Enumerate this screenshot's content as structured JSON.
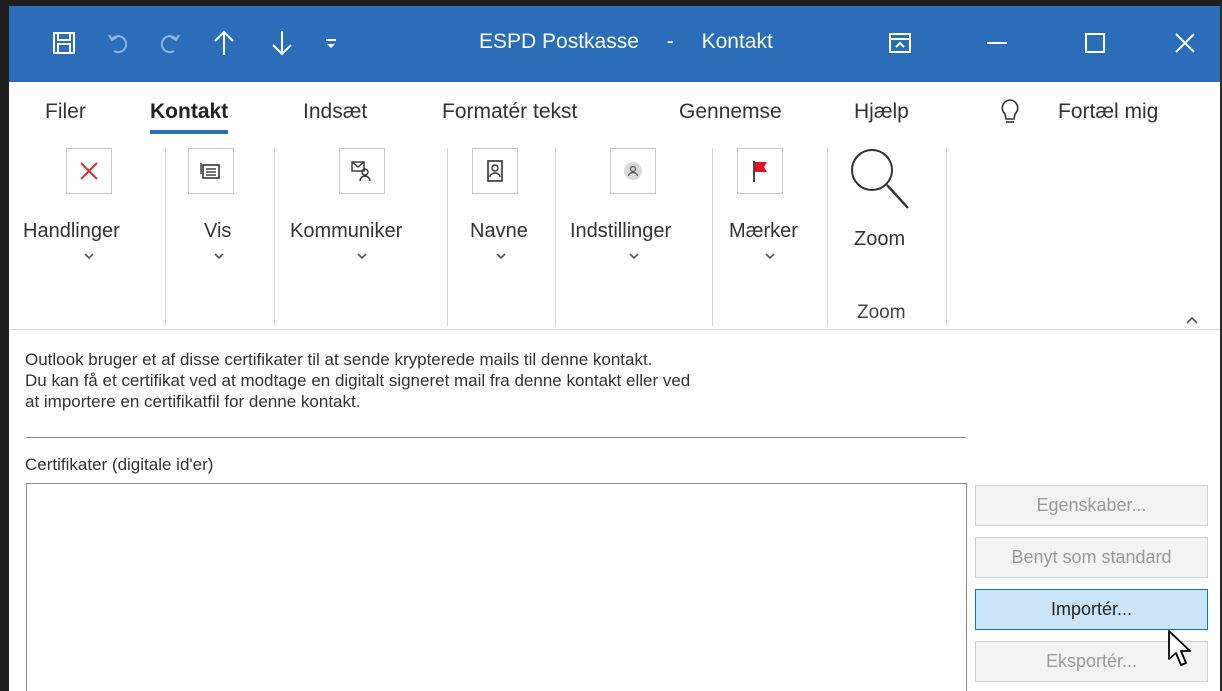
{
  "window": {
    "title_app": "ESPD Postkasse",
    "title_sep": "-",
    "title_item": "Kontakt",
    "quick_access": [
      "save-icon",
      "undo-icon",
      "redo-icon",
      "up-arrow-icon",
      "down-arrow-icon",
      "customize-icon"
    ],
    "accent_color": "#2b6db8"
  },
  "tabs": [
    {
      "label": "Filer",
      "active": false
    },
    {
      "label": "Kontakt",
      "active": true
    },
    {
      "label": "Indsæt",
      "active": false
    },
    {
      "label": "Formatér tekst",
      "active": false
    },
    {
      "label": "Gennemse",
      "active": false
    },
    {
      "label": "Hjælp",
      "active": false
    }
  ],
  "tell_me": "Fortæl mig",
  "ribbon": {
    "groups": [
      {
        "label": "Handlinger",
        "icon": "delete-icon"
      },
      {
        "label": "Vis",
        "icon": "view-icon"
      },
      {
        "label": "Kommuniker",
        "icon": "communicate-icon"
      },
      {
        "label": "Navne",
        "icon": "names-icon"
      },
      {
        "label": "Indstillinger",
        "icon": "settings-icon"
      },
      {
        "label": "Mærker",
        "icon": "flag-icon"
      },
      {
        "label": "Zoom",
        "icon": "zoom-icon"
      }
    ],
    "zoom_group_label": "Zoom"
  },
  "content": {
    "info_line1": "Outlook bruger et af disse certifikater til at sende krypterede mails til denne kontakt.",
    "info_line2": "Du kan få et certifikat ved at modtage en digitalt signeret mail fra denne kontakt eller ved",
    "info_line3": "at importere en certifikatfil for denne kontakt.",
    "cert_label": "Certifikater (digitale id'er)",
    "buttons": [
      {
        "label": "Egenskaber...",
        "enabled": false
      },
      {
        "label": "Benyt som standard",
        "enabled": false
      },
      {
        "label": "Importér...",
        "enabled": true
      },
      {
        "label": "Eksportér...",
        "enabled": false
      }
    ]
  }
}
